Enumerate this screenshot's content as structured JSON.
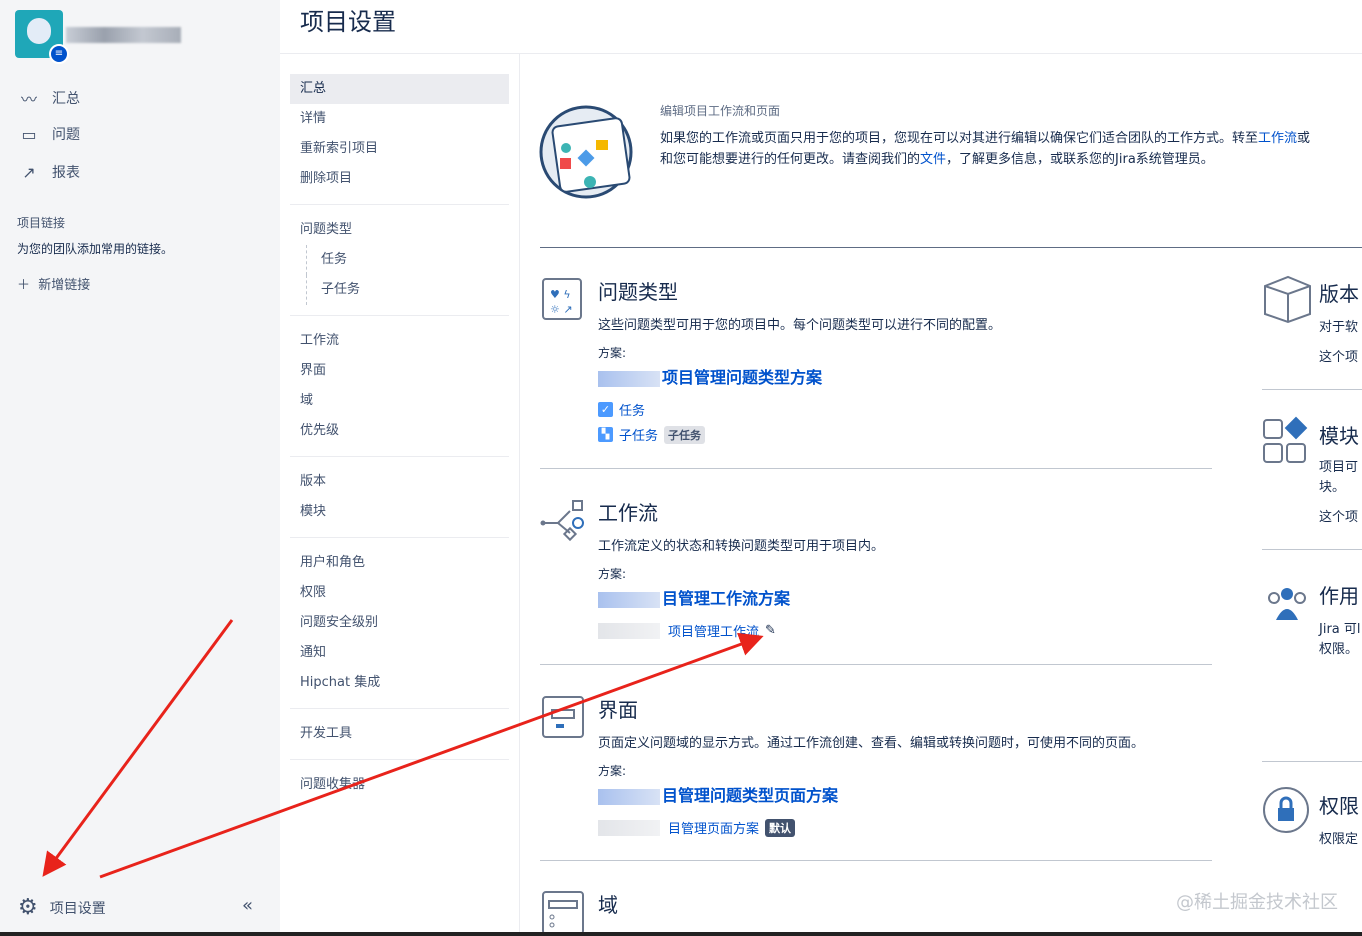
{
  "sidebar": {
    "nav": [
      {
        "label": "汇总",
        "icon": "activity-icon"
      },
      {
        "label": "问题",
        "icon": "issues-icon"
      },
      {
        "label": "报表",
        "icon": "chart-icon"
      }
    ],
    "links_heading": "项目链接",
    "links_desc": "为您的团队添加常用的链接。",
    "add_link": "新增链接",
    "settings": "项目设置",
    "collapse": "«"
  },
  "header": {
    "title": "项目设置"
  },
  "settings_nav": {
    "groups": [
      [
        "汇总",
        "详情",
        "重新索引项目",
        "删除项目"
      ],
      [
        "问题类型",
        "任务",
        "子任务"
      ],
      [
        "工作流",
        "界面",
        "域",
        "优先级"
      ],
      [
        "版本",
        "模块"
      ],
      [
        "用户和角色",
        "权限",
        "问题安全级别",
        "通知",
        "Hipchat 集成"
      ],
      [
        "开发工具"
      ],
      [
        "问题收集器"
      ]
    ]
  },
  "banner": {
    "heading": "编辑项目工作流和页面",
    "text1": "如果您的工作流或页面只用于您的项目，您现在可以对其进行编辑以确保它们适合团队的工作方式。转至",
    "link1": "工作流",
    "text1b": "或",
    "text2a": "和您可能想要进行的任何更改。请查阅我们的",
    "link2": "文件",
    "text2b": "，了解更多信息，或联系您的Jira系统管理员。"
  },
  "sections": {
    "issue_types": {
      "title": "问题类型",
      "desc": "这些问题类型可用于您的项目中。每个问题类型可以进行不同的配置。",
      "scheme_label": "方案:",
      "scheme": "项目管理问题类型方案",
      "items": [
        {
          "label": "任务"
        },
        {
          "label": "子任务",
          "tag": "子任务"
        }
      ]
    },
    "workflow": {
      "title": "工作流",
      "desc": "工作流定义的状态和转换问题类型可用于项目内。",
      "scheme_label": "方案:",
      "scheme": "目管理工作流方案",
      "item": "项目管理工作流"
    },
    "screens": {
      "title": "界面",
      "desc": "页面定义问题域的显示方式。通过工作流创建、查看、编辑或转换问题时，可使用不同的页面。",
      "scheme_label": "方案:",
      "scheme": "目管理问题类型页面方案",
      "item": "目管理页面方案",
      "tag": "默认"
    },
    "fields": {
      "title": "域"
    }
  },
  "right": {
    "versions": {
      "title": "版本",
      "l1": "对于软",
      "l2": "这个项"
    },
    "components": {
      "title": "模块",
      "l1": "项目可",
      "l2": "块。",
      "l3": "这个项"
    },
    "roles": {
      "title": "作用",
      "l1": "Jira 可l",
      "l2": "权限。"
    },
    "permissions": {
      "title": "权限",
      "l1": "权限定"
    }
  },
  "watermark": "@稀土掘金技术社区",
  "colors": {
    "link": "#0052cc",
    "sidebar": "#f4f5f7",
    "annotation": "#e8231b"
  }
}
